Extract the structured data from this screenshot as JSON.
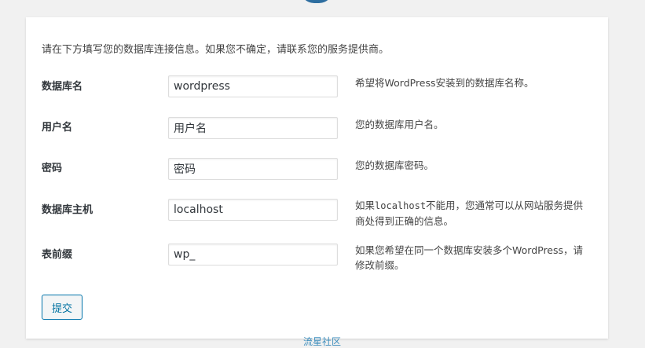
{
  "intro": "请在下方填写您的数据库连接信息。如果您不确定，请联系您的服务提供商。",
  "fields": [
    {
      "label": "数据库名",
      "value": "wordpress",
      "help": "希望将WordPress安装到的数据库名称。"
    },
    {
      "label": "用户名",
      "value": "用户名",
      "help": "您的数据库用户名。"
    },
    {
      "label": "密码",
      "value": "密码",
      "help": "您的数据库密码。"
    },
    {
      "label": "数据库主机",
      "value": "localhost",
      "help_pre": "如果",
      "help_code": "localhost",
      "help_post": "不能用，您通常可以从网站服务提供商处得到正确的信息。"
    },
    {
      "label": "表前缀",
      "value": "wp_",
      "help": "如果您希望在同一个数据库安装多个WordPress，请修改前缀。"
    }
  ],
  "submit_label": "提交",
  "footer_link": "流星社区",
  "colors": {
    "accent": "#0073aa",
    "background": "#f1f1f1",
    "card": "#ffffff"
  }
}
